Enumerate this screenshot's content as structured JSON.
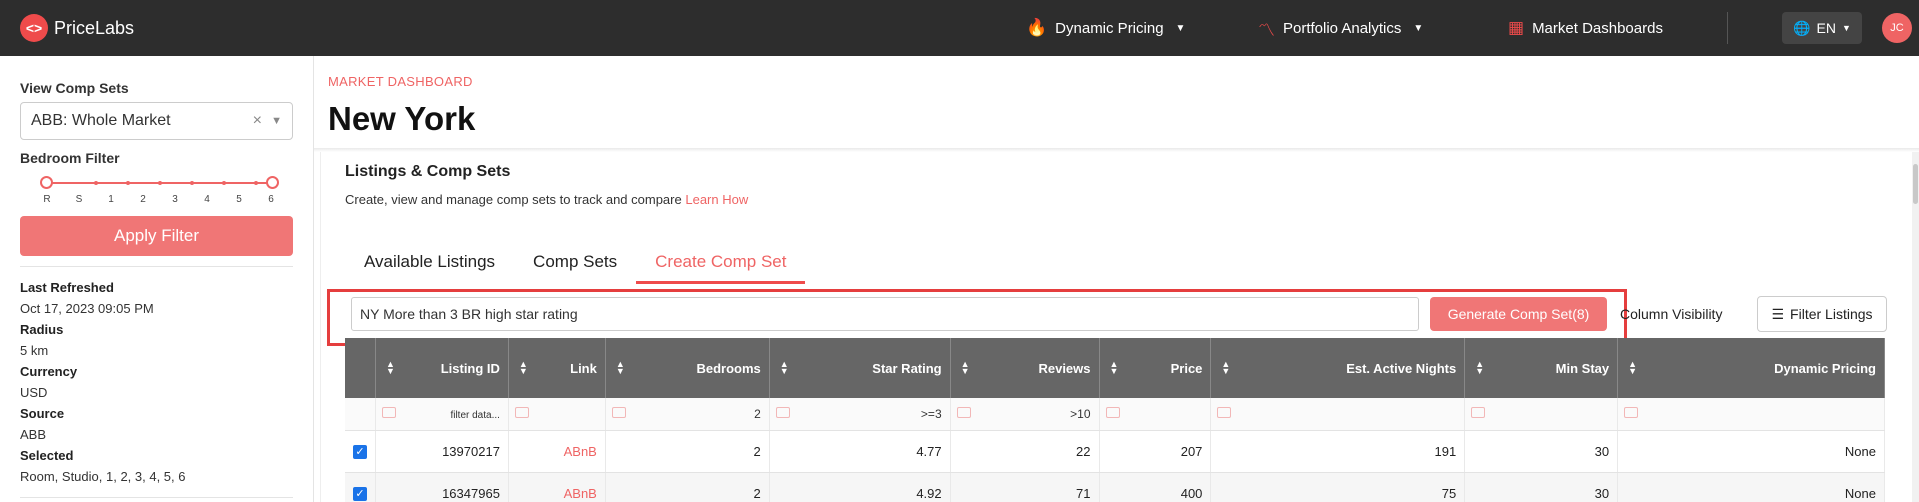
{
  "app": {
    "logo_text": "PriceLabs"
  },
  "nav": {
    "dynamic_pricing": "Dynamic Pricing",
    "portfolio_analytics": "Portfolio Analytics",
    "market_dashboards": "Market Dashboards",
    "language": "EN",
    "avatar_initials": "JC"
  },
  "sidebar": {
    "view_comp_sets_label": "View Comp Sets",
    "selected_comp_set": "ABB: Whole Market",
    "bedroom_filter_label": "Bedroom Filter",
    "bedroom_ticks": [
      "R",
      "S",
      "1",
      "2",
      "3",
      "4",
      "5",
      "6"
    ],
    "apply_label": "Apply Filter",
    "info": [
      {
        "key": "Last Refreshed",
        "value": "Oct 17, 2023 09:05 PM"
      },
      {
        "key": "Radius",
        "value": "5 km"
      },
      {
        "key": "Currency",
        "value": "USD"
      },
      {
        "key": "Source",
        "value": "ABB"
      },
      {
        "key": "Selected",
        "value": "Room, Studio, 1, 2, 3, 4, 5, 6"
      }
    ]
  },
  "main": {
    "breadcrumb": "MARKET DASHBOARD",
    "title": "New York",
    "panel_title": "Listings & Comp Sets",
    "panel_subtitle": "Create, view and manage comp sets to track and compare",
    "learn_how": "Learn How",
    "tabs": [
      "Available Listings",
      "Comp Sets",
      "Create Comp Set"
    ],
    "active_tab": 2,
    "comp_set_name": "NY More than 3 BR high star rating",
    "generate_label": "Generate Comp Set(8)",
    "column_visibility": "Column Visibility",
    "filter_listings": "Filter Listings"
  },
  "table": {
    "headers": [
      "",
      "Listing ID",
      "Link",
      "Bedrooms",
      "Star Rating",
      "Reviews",
      "Price",
      "Est. Active Nights",
      "Min Stay",
      "Dynamic Pricing"
    ],
    "filters": [
      "",
      "filter data...",
      "",
      "2",
      ">=3",
      ">10",
      "",
      "",
      "",
      ""
    ],
    "rows": [
      [
        "",
        "13970217",
        "ABnB",
        "2",
        "4.77",
        "22",
        "207",
        "191",
        "30",
        "None"
      ],
      [
        "",
        "16347965",
        "ABnB",
        "2",
        "4.92",
        "71",
        "400",
        "75",
        "30",
        "None"
      ]
    ]
  },
  "colors": {
    "accent": "#ef6464",
    "topbar": "#2d2d2d",
    "table_header": "#666666",
    "highlight": "#e53e3e"
  }
}
